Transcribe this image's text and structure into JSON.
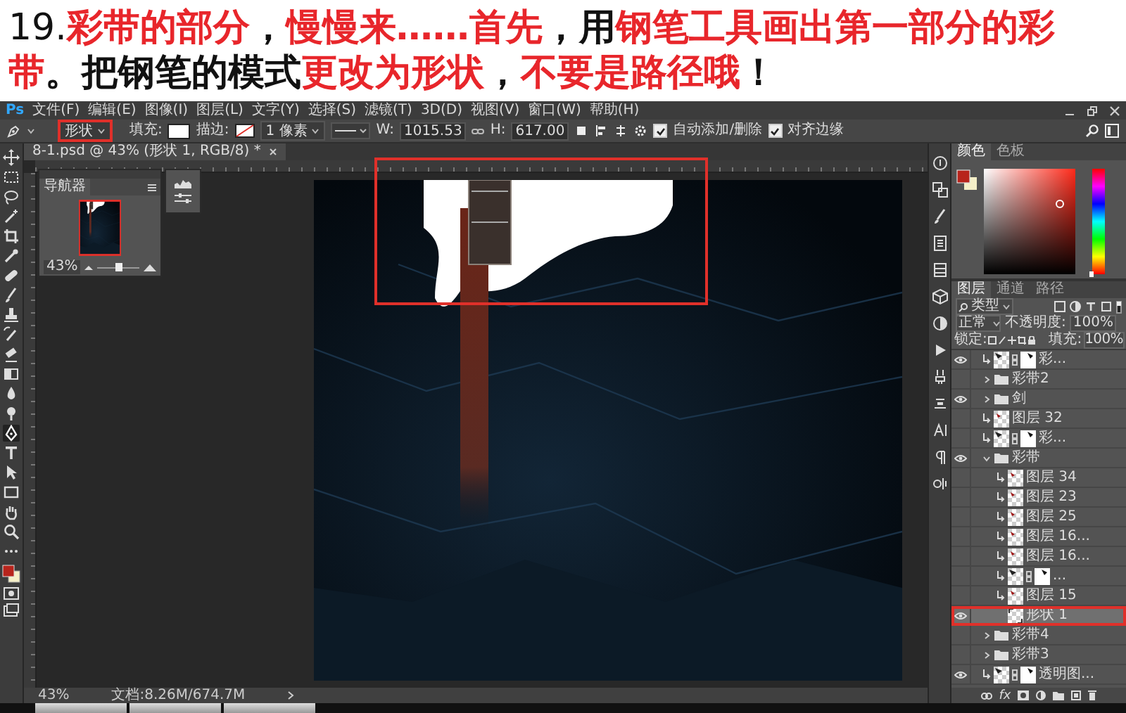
{
  "caption": {
    "number": "19.",
    "segments": [
      {
        "text": "彩带的部分",
        "highlight": true
      },
      {
        "text": "，",
        "highlight": false
      },
      {
        "text": "慢慢来……首先",
        "highlight": true
      },
      {
        "text": "，用",
        "highlight": false
      },
      {
        "text": "钢笔工具画出第一部分的彩带",
        "highlight": true
      },
      {
        "text": "。把钢笔的模式",
        "highlight": false
      },
      {
        "text": "更改为形状",
        "highlight": true
      },
      {
        "text": "，",
        "highlight": false
      },
      {
        "text": "不要是路径哦",
        "highlight": true
      },
      {
        "text": "！",
        "highlight": false
      }
    ]
  },
  "menubar": {
    "logo": "Ps",
    "menus": [
      "文件(F)",
      "编辑(E)",
      "图像(I)",
      "图层(L)",
      "文字(Y)",
      "选择(S)",
      "滤镜(T)",
      "3D(D)",
      "视图(V)",
      "窗口(W)",
      "帮助(H)"
    ]
  },
  "options": {
    "mode": {
      "value": "形状",
      "annotated": true
    },
    "fill_label": "填充:",
    "stroke_label": "描边:",
    "stroke_width": "1 像素",
    "w_label": "W:",
    "w_value": "1015.53",
    "h_label": "H:",
    "h_value": "617.00",
    "checkboxes": [
      {
        "label": "自动添加/删除",
        "checked": true
      },
      {
        "label": "对齐边缘",
        "checked": true
      }
    ]
  },
  "toolbox": {
    "tools": [
      {
        "kind": "move",
        "selected": false
      },
      {
        "kind": "marquee",
        "selected": false
      },
      {
        "kind": "lasso",
        "selected": false
      },
      {
        "kind": "wand",
        "selected": false
      },
      {
        "kind": "crop",
        "selected": false
      },
      {
        "kind": "eyedropper",
        "selected": false
      },
      {
        "kind": "bandage",
        "selected": false
      },
      {
        "kind": "brush",
        "selected": false
      },
      {
        "kind": "stamp",
        "selected": false
      },
      {
        "kind": "history",
        "selected": false
      },
      {
        "kind": "eraser",
        "selected": false
      },
      {
        "kind": "gradient",
        "selected": false
      },
      {
        "kind": "drop",
        "selected": false
      },
      {
        "kind": "dodge",
        "selected": false
      },
      {
        "kind": "pen",
        "selected": true
      },
      {
        "kind": "type",
        "selected": false
      },
      {
        "kind": "arrow",
        "selected": false
      },
      {
        "kind": "rectangle",
        "selected": false
      },
      {
        "kind": "hand",
        "selected": false
      },
      {
        "kind": "zoom",
        "selected": false
      },
      {
        "kind": "more",
        "selected": false
      }
    ]
  },
  "document": {
    "tab_title": "8-1.psd @ 43% (形状 1, RGB/8) *",
    "annotated": true
  },
  "navigator": {
    "title": "导航器",
    "zoom": "43%",
    "level": 0.5
  },
  "status_bar": {
    "zoom": "43%",
    "info": "文档:8.26M/674.7M"
  },
  "color_panel": {
    "tabs": [
      {
        "label": "颜色",
        "selected": true
      },
      {
        "label": "色板",
        "selected": false
      }
    ],
    "hue": {
      "level": 0
    }
  },
  "layers_panel": {
    "tabs": [
      {
        "label": "图层",
        "selected": true
      },
      {
        "label": "通道",
        "selected": false
      },
      {
        "label": "路径",
        "selected": false
      }
    ],
    "filter": "类型",
    "blend_mode": "正常",
    "opacity_label": "不透明度:",
    "opacity": "100%",
    "lock_label": "锁定:",
    "fill_label": "填充:",
    "fill": "100%",
    "footer_fx": "fx",
    "layers": [
      {
        "kind": "mask",
        "name": "彩...",
        "visible": true,
        "selected": false,
        "clipped": true
      },
      {
        "kind": "group",
        "name": "彩带2",
        "visible": false,
        "selected": false,
        "expanded": false
      },
      {
        "kind": "group",
        "name": "剑",
        "visible": true,
        "selected": false,
        "expanded": false
      },
      {
        "kind": "layer",
        "name": "图层 32",
        "visible": false,
        "selected": false,
        "clipped": true
      },
      {
        "kind": "mask",
        "name": "彩...",
        "visible": false,
        "selected": false,
        "clipped": true
      },
      {
        "kind": "group",
        "name": "彩带",
        "visible": true,
        "selected": false,
        "expanded": true,
        "children": [
          {
            "kind": "layer",
            "name": "图层 34",
            "visible": false,
            "selected": false,
            "clipped": true
          },
          {
            "kind": "layer",
            "name": "图层 23",
            "visible": false,
            "selected": false,
            "clipped": true
          },
          {
            "kind": "layer",
            "name": "图层 25",
            "visible": false,
            "selected": false,
            "clipped": true
          },
          {
            "kind": "layer",
            "name": "图层 16...",
            "visible": false,
            "selected": false,
            "clipped": true
          },
          {
            "kind": "layer",
            "name": "图层 16...",
            "visible": false,
            "selected": false,
            "clipped": true
          },
          {
            "kind": "mask",
            "name": "...",
            "visible": false,
            "selected": false,
            "clipped": true
          },
          {
            "kind": "layer",
            "name": "图层 15",
            "visible": false,
            "selected": false,
            "clipped": true
          },
          {
            "kind": "shape",
            "name": "形状 1",
            "visible": true,
            "selected": true,
            "clipped": false,
            "annotated": true
          }
        ]
      },
      {
        "kind": "group",
        "name": "彩带4",
        "visible": false,
        "selected": false,
        "expanded": false
      },
      {
        "kind": "group",
        "name": "彩带3",
        "visible": false,
        "selected": false,
        "expanded": false
      },
      {
        "kind": "mask",
        "name": "透明图...",
        "visible": true,
        "selected": false,
        "clipped": true
      }
    ]
  }
}
